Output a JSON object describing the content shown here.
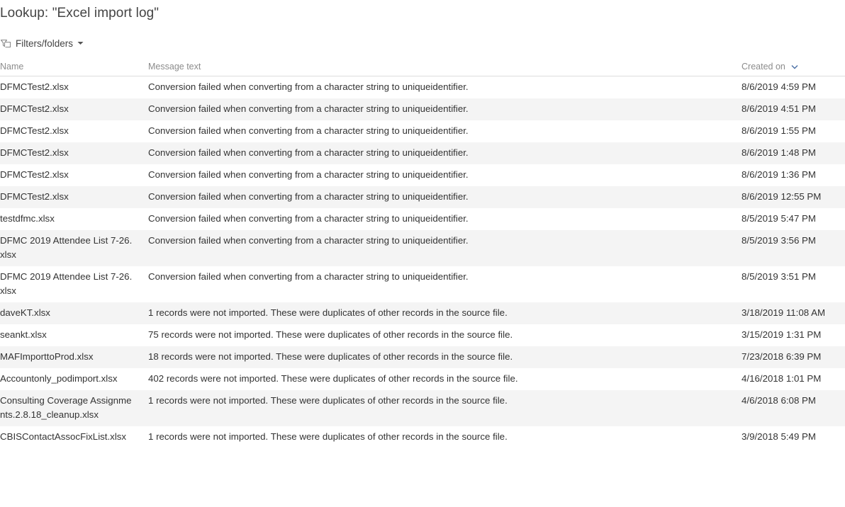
{
  "title": "Lookup: \"Excel import log\"",
  "filters": {
    "label": "Filters/folders"
  },
  "columns": {
    "name": "Name",
    "message": "Message text",
    "created": "Created on"
  },
  "rows": [
    {
      "name": "DFMCTest2.xlsx",
      "message": "Conversion failed when converting from a character string to uniqueidentifier.",
      "created": "8/6/2019 4:59 PM"
    },
    {
      "name": "DFMCTest2.xlsx",
      "message": "Conversion failed when converting from a character string to uniqueidentifier.",
      "created": "8/6/2019 4:51 PM"
    },
    {
      "name": "DFMCTest2.xlsx",
      "message": "Conversion failed when converting from a character string to uniqueidentifier.",
      "created": "8/6/2019 1:55 PM"
    },
    {
      "name": "DFMCTest2.xlsx",
      "message": "Conversion failed when converting from a character string to uniqueidentifier.",
      "created": "8/6/2019 1:48 PM"
    },
    {
      "name": "DFMCTest2.xlsx",
      "message": "Conversion failed when converting from a character string to uniqueidentifier.",
      "created": "8/6/2019 1:36 PM"
    },
    {
      "name": "DFMCTest2.xlsx",
      "message": "Conversion failed when converting from a character string to uniqueidentifier.",
      "created": "8/6/2019 12:55 PM"
    },
    {
      "name": "testdfmc.xlsx",
      "message": "Conversion failed when converting from a character string to uniqueidentifier.",
      "created": "8/5/2019 5:47 PM"
    },
    {
      "name": "DFMC 2019 Attendee List 7-26.xlsx",
      "message": "Conversion failed when converting from a character string to uniqueidentifier.",
      "created": "8/5/2019 3:56 PM"
    },
    {
      "name": "DFMC 2019 Attendee List 7-26.xlsx",
      "message": "Conversion failed when converting from a character string to uniqueidentifier.",
      "created": "8/5/2019 3:51 PM"
    },
    {
      "name": "daveKT.xlsx",
      "message": "1 records were not imported. These were duplicates of other records in the source file.",
      "created": "3/18/2019 11:08 AM"
    },
    {
      "name": "seankt.xlsx",
      "message": "75 records were not imported. These were duplicates of other records in the source file.",
      "created": "3/15/2019 1:31 PM"
    },
    {
      "name": "MAFImporttoProd.xlsx",
      "message": "18 records were not imported. These were duplicates of other records in the source file.",
      "created": "7/23/2018 6:39 PM"
    },
    {
      "name": "Accountonly_podimport.xlsx",
      "message": "402 records were not imported. These were duplicates of other records in the source file.",
      "created": "4/16/2018 1:01 PM"
    },
    {
      "name": "Consulting Coverage Assignments.2.8.18_cleanup.xlsx",
      "message": "1 records were not imported. These were duplicates of other records in the source file.",
      "created": "4/6/2018 6:08 PM"
    },
    {
      "name": "CBISContactAssocFixList.xlsx",
      "message": "1 records were not imported. These were duplicates of other records in the source file.",
      "created": "3/9/2018 5:49 PM"
    }
  ],
  "icons": {
    "filter": "filter-folders-icon",
    "dropdown": "caret-down-icon",
    "sort": "sort-descending-icon"
  },
  "colors": {
    "header_text": "#8c8c8c",
    "row_alt": "#f4f4f4",
    "text": "#333333"
  }
}
